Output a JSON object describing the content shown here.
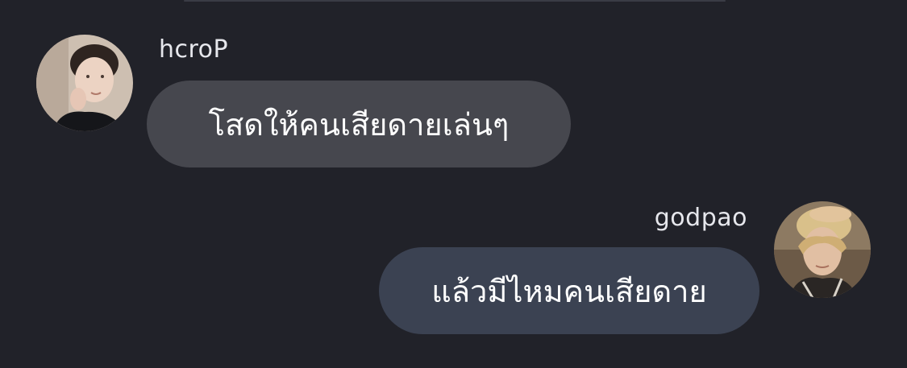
{
  "messages": [
    {
      "side": "left",
      "username": "hcroP",
      "avatar_icon": "avatar-photo-person",
      "text": "โสดให้คนเสียดายเล่นๆ"
    },
    {
      "side": "right",
      "username": "godpao",
      "avatar_icon": "avatar-photo-person",
      "text": "แล้วมีไหมคนเสียดาย"
    }
  ],
  "colors": {
    "background": "#212229",
    "incoming_bubble": "#46474e",
    "outgoing_bubble": "#3b4252",
    "username_text": "#e6e7ec",
    "message_text": "#ffffff"
  }
}
